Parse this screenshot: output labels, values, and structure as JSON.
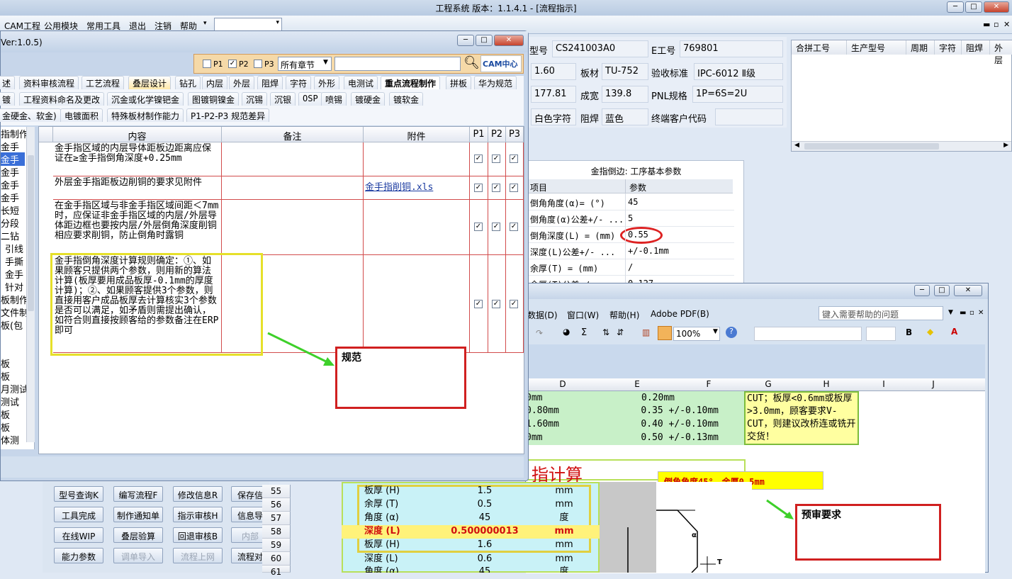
{
  "window": {
    "title": "工程系统   版本：1.1.4.1 - [流程指示]"
  },
  "menubar": {
    "items": [
      "CAM工程",
      "公用模块",
      "常用工具",
      "退出",
      "注销",
      "帮助"
    ]
  },
  "info": {
    "model_label": "型号",
    "model_value": "CS241003A0",
    "eno_label": "E工号",
    "eno_value": "769801",
    "thickness_value": "1.60",
    "board_label": "板材",
    "board_value": "TU-752",
    "std_label": "验收标准",
    "std_value": "IPC-6012 Ⅱ级",
    "len_value": "177.81",
    "width_label": "成宽",
    "width_value": "139.8",
    "pnl_label": "PNL规格",
    "pnl_value": "1P=6S=2U",
    "legend_value": "白色字符",
    "mask_label": "阻焊",
    "mask_value": "蓝色",
    "endcust_label": "终端客户代码"
  },
  "gridhdr": [
    "合拼工号",
    "生产型号",
    "周期",
    "字符",
    "阻焊",
    "外层"
  ],
  "params": {
    "title": "金指倒边: 工序基本参数",
    "col_item": "项目",
    "col_param": "参数",
    "rows": [
      {
        "item": "倒角角度(α)=  (°)",
        "val": "45"
      },
      {
        "item": "倒角度(α)公差+/- ...",
        "val": "5"
      },
      {
        "item": "倒角深度(L) =  (mm)",
        "val": "0.55"
      },
      {
        "item": "深度(L)公差+/- ...",
        "val": "+/-0.1mm"
      },
      {
        "item": "余厚(T) =  (mm)",
        "val": "/"
      },
      {
        "item": "余厚(T)公差+/-",
        "val": "0.127"
      }
    ]
  },
  "dialog": {
    "version": "Ver:1.0.5)",
    "filter": {
      "p1": "P1",
      "p2": "P2",
      "p3": "P3",
      "chapter": "所有章节",
      "logo": "CAM中心"
    },
    "tabs_row1": [
      "述",
      "资料审核流程",
      "工艺流程",
      "叠层设计",
      "钻孔",
      "内层",
      "外层",
      "阻焊",
      "字符",
      "外形",
      "电测试",
      "重点流程制作",
      "拼板",
      "华为规范"
    ],
    "tabs_row2": [
      "镀",
      "工程资料命名及更改",
      "沉金或化学镍钯金",
      "图镀铜镍金",
      "沉锡",
      "沉银",
      "OSP",
      "喷锡",
      "镀硬金",
      "镀软金"
    ],
    "tabs_row3": [
      "金硬金、软金)",
      "电镀面积",
      "特殊板材制作能力",
      "P1-P2-P3 规范差异"
    ],
    "left_items": [
      "指制作",
      "金手",
      "金手",
      "金手",
      "金手",
      "金手",
      "长短",
      "分段",
      "二钻",
      "引线",
      "手撕",
      "金手",
      "针对",
      "板制作",
      "文件制",
      "板(包",
      "",
      "板",
      "板",
      "月测试",
      "测试",
      "板",
      "板",
      "体测"
    ],
    "headers": {
      "content": "内容",
      "note": "备注",
      "attach": "附件",
      "p1": "P1",
      "p2": "P2",
      "p3": "P3"
    },
    "rows": [
      {
        "content": "金手指区域的内层导体距板边距离应保证在≥金手指倒角深度+0.25mm",
        "attach": ""
      },
      {
        "content": "外层金手指距板边削铜的要求见附件",
        "attach": "金手指削铜.xls"
      },
      {
        "content": "在金手指区域与非金手指区域间距＜7mm时，应保证非金手指区域的内层/外层导体距边框也要按内层/外层倒角深度削铜相应要求削铜，防止倒角时露铜",
        "attach": ""
      },
      {
        "content": "金手指倒角深度计算规则确定：①、如果顾客只提供两个参数，则用新的算法计算(板厚要用成品板厚-0.1mm的厚度计算)；②、如果顾客提供3个参数，则直接用客户成品板厚去计算核实3个参数是否可以满足，如矛盾则需提出确认，如符合则直接按顾客给的参数备注在ERP即可",
        "attach": ""
      }
    ],
    "check": "✓"
  },
  "annotations": {
    "spec": "规范",
    "review": "预审要求",
    "excel_note": "倒角角度45°，余厚0.5mm"
  },
  "buttons": [
    [
      "型号查询K",
      "编写流程F",
      "修改信息R",
      "保存信"
    ],
    [
      "工具完成",
      "制作通知单",
      "指示审核H",
      "信息导"
    ],
    [
      "在线WIP",
      "叠层验算",
      "回退审核B",
      "内部"
    ],
    [
      "能力参数",
      "调单导入",
      "流程上网",
      "流程对"
    ]
  ],
  "excel": {
    "menu": [
      "数据(D)",
      "窗口(W)",
      "帮助(H)",
      "Adobe PDF(B)"
    ],
    "help_placeholder": "键入需要帮助的问题",
    "zoom": "100%",
    "cols": [
      "D",
      "E",
      "F",
      "G",
      "H",
      "I",
      "J"
    ],
    "top_rows": [
      {
        "d": "0mm",
        "e": "0.20mm"
      },
      {
        "d": "0.80mm",
        "e": "0.35 +/-0.10mm"
      },
      {
        "d": "1.60mm",
        "e": "0.40 +/-0.10mm"
      },
      {
        "d": "0mm",
        "e": "0.50 +/-0.13mm"
      }
    ],
    "note": "CUT；板厚<0.6mm或板厚>3.0mm，顾客要求V-CUT，则建议改桥连或铣开交货！",
    "calc_title": "指计算",
    "rownums": [
      "55",
      "56",
      "57",
      "58",
      "59",
      "60",
      "61"
    ],
    "calc_rows": [
      {
        "label": "板厚 (H)",
        "val": "1.5",
        "unit": "mm"
      },
      {
        "label": "余厚 (T)",
        "val": "0.5",
        "unit": "mm"
      },
      {
        "label": "角度 (α)",
        "val": "45",
        "unit": "度"
      },
      {
        "label": "深度 (L)",
        "val": "0.500000013",
        "unit": "mm"
      },
      {
        "label": "板厚 (H)",
        "val": "1.6",
        "unit": "mm"
      },
      {
        "label": "深度 (L)",
        "val": "0.6",
        "unit": "mm"
      },
      {
        "label": "角度 (α)",
        "val": "45",
        "unit": "度"
      }
    ],
    "alpha": "α",
    "t_label": "T"
  }
}
